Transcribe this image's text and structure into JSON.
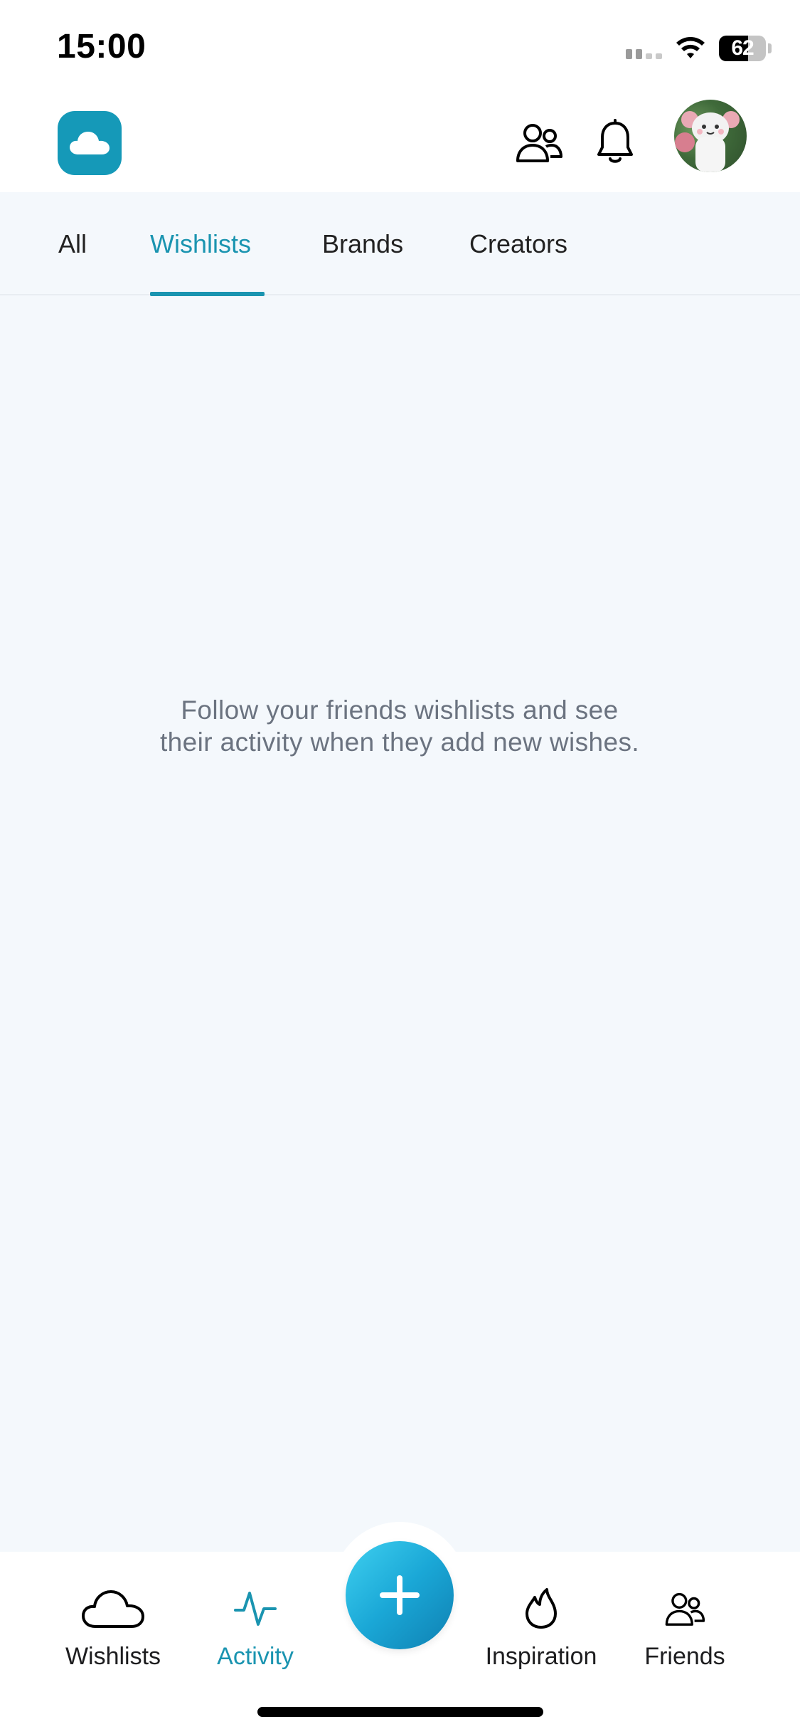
{
  "status_bar": {
    "time": "15:00",
    "battery_level": "62",
    "battery_fraction": 0.62
  },
  "header": {
    "logo_icon": "cloud-icon",
    "actions": [
      "friends-icon",
      "bell-icon"
    ],
    "avatar": "profile-avatar"
  },
  "tabs": {
    "items": [
      "All",
      "Wishlists",
      "Brands",
      "Creators"
    ],
    "active": "Wishlists"
  },
  "empty_state": {
    "line1": "Follow your friends wishlists and see",
    "line2": "their activity when they add new wishes."
  },
  "bottom_nav": {
    "items": [
      {
        "label": "Wishlists",
        "icon": "cloud-icon"
      },
      {
        "label": "Activity",
        "icon": "activity-icon"
      },
      {
        "label": "Inspiration",
        "icon": "flame-icon"
      },
      {
        "label": "Friends",
        "icon": "friends-icon"
      }
    ],
    "active": "Activity",
    "add_button_icon": "plus-icon"
  },
  "colors": {
    "accent": "#1a94b0",
    "background": "#f4f8fc",
    "text_muted": "#6b7380"
  }
}
